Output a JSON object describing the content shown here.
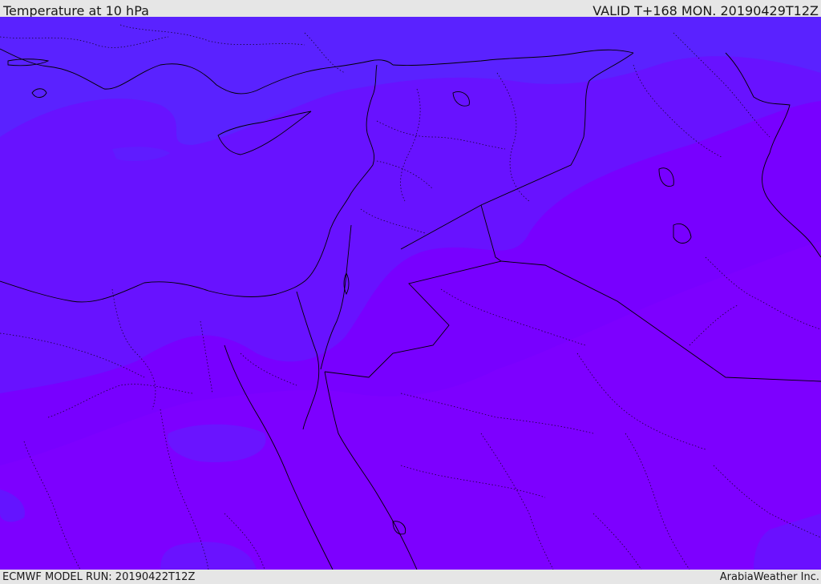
{
  "header": {
    "title": "Temperature at 10 hPa",
    "valid_time": "VALID T+168 MON. 20190429T12Z"
  },
  "footer": {
    "model_run": "ECMWF MODEL RUN: 20190422T12Z",
    "provider": "ArabiaWeather Inc."
  },
  "colors": {
    "field_cool": "#5a22ff",
    "field_mid": "#6a10ff",
    "field_warm": "#7d00ff",
    "coastline": "#000000",
    "border": "#000000"
  }
}
